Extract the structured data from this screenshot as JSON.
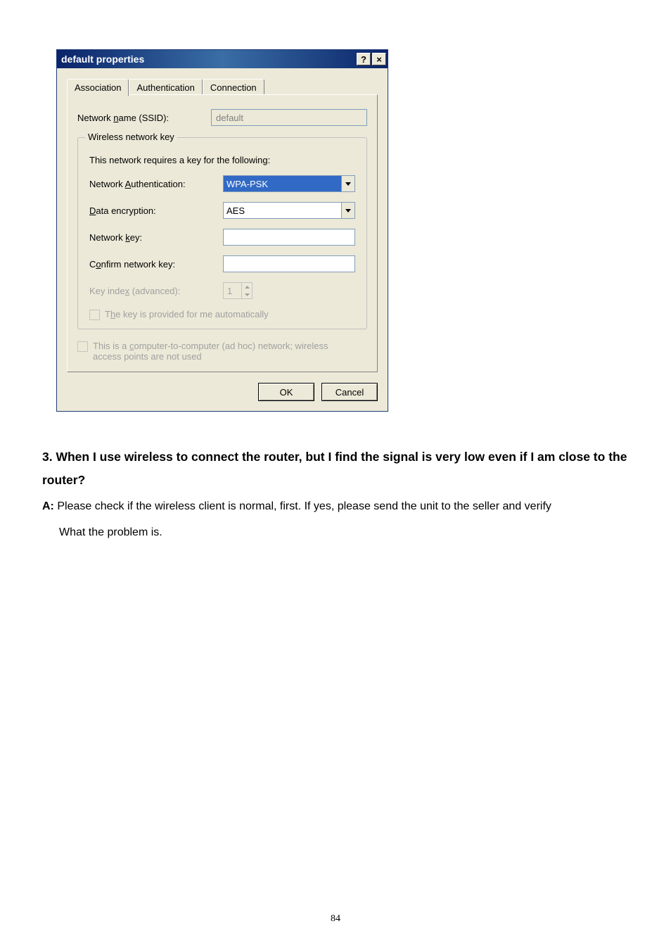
{
  "dialog": {
    "title": "default properties",
    "help_icon": "?",
    "close_icon": "×",
    "tabs": [
      "Association",
      "Authentication",
      "Connection"
    ],
    "ssid_value": "default",
    "group_title": "Wireless network key",
    "group_desc": "This network requires a key for the following:",
    "auth_value": "WPA-PSK",
    "encrypt_value": "AES",
    "key_index_value": "1",
    "ok_label": "OK",
    "cancel_label": "Cancel"
  },
  "doc": {
    "question": "3. When I use wireless to connect the router, but I find the signal is very low even if I am close to the router?",
    "answer_prefix": "A:",
    "answer_line1": "Please check if the wireless client is normal, first. If yes, please send the unit to the seller and verify",
    "answer_line2": "What the problem is.",
    "page_number": "84"
  }
}
